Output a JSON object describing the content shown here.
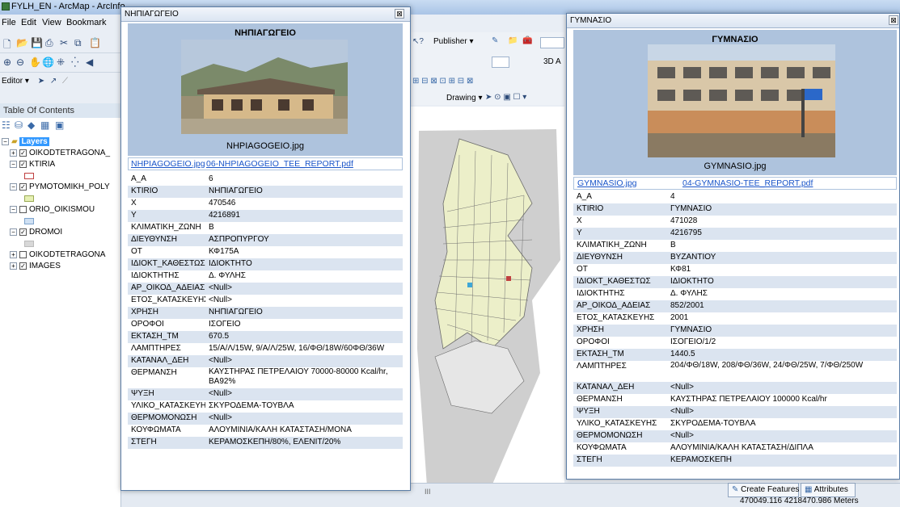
{
  "app": {
    "title": "FYLH_EN - ArcMap - ArcInfo",
    "menu": [
      "File",
      "Edit",
      "View",
      "Bookmark"
    ],
    "editor_label": "Editor ▾",
    "toc_title": "Table Of Contents",
    "publisher_label": "Publisher ▾",
    "drawing_label": "Drawing ▾",
    "three_d_label": "3D A",
    "status_coords": "470049.116 4218470.986 Meters",
    "tab_create_features": "Create Features",
    "tab_attributes": "Attributes",
    "scroll_mark": "III"
  },
  "toc": {
    "root": "Layers",
    "layers": [
      {
        "name": "OIKODTETRAGONA_",
        "checked": true,
        "expanded": false
      },
      {
        "name": "KTIRIA",
        "checked": true,
        "expanded": true,
        "swatch": "#c04040"
      },
      {
        "name": "PYMOTOMIKH_POLY",
        "checked": true,
        "expanded": true,
        "swatch": "#e6f0b4"
      },
      {
        "name": "ORIO_OIKISMOU",
        "checked": false,
        "expanded": true,
        "swatch": "#cfe0f3"
      },
      {
        "name": "DROMOI",
        "checked": true,
        "expanded": true,
        "swatch": "#d8d8d8"
      },
      {
        "name": "OIKODTETRAGONA",
        "checked": false,
        "expanded": false
      },
      {
        "name": "IMAGES",
        "checked": true,
        "expanded": false
      }
    ]
  },
  "popup_left": {
    "window_title": "ΝΗΠΙΑΓΩΓΕΙΟ",
    "header": "ΝΗΠΙΑΓΩΓΕΙΟ",
    "caption": "NHPIAGOGEIO.jpg",
    "link1": "NHPIAGOGEIO.jpg",
    "link2": "06-NHPIAGOGEIO_TEE_REPORT.pdf",
    "rows": [
      [
        "A_A",
        "6"
      ],
      [
        "KTIRIO",
        "ΝΗΠΙΑΓΩΓΕΙΟ"
      ],
      [
        "X",
        "470546"
      ],
      [
        "Y",
        "4216891"
      ],
      [
        "ΚΛΙΜΑΤΙΚΗ_ΖΩΝΗ",
        "Β"
      ],
      [
        "ΔΙΕΥΘΥΝΣΗ",
        "ΑΣΠΡΟΠΥΡΓΟΥ"
      ],
      [
        "ΟΤ",
        "ΚΦ175Α"
      ],
      [
        "ΙΔΙΟΚΤ_ΚΑΘΕΣΤΩΣ",
        "ΙΔΙΟΚΤΗΤΟ"
      ],
      [
        "ΙΔΙΟΚΤΗΤΗΣ",
        "Δ. ΦΥΛΗΣ"
      ],
      [
        "ΑΡ_ΟΙΚΟΔ_ΑΔΕΙΑΣ",
        "<Null>"
      ],
      [
        "ΕΤΟΣ_ΚΑΤΑΣΚΕΥΗΣ",
        "<Null>"
      ],
      [
        "ΧΡΗΣΗ",
        "ΝΗΠΙΑΓΩΓΕΙΟ"
      ],
      [
        "ΟΡΟΦΟΙ",
        "ΙΣΟΓΕΙΟ"
      ],
      [
        "ΕΚΤΑΣΗ_ΤΜ",
        "670.5"
      ],
      [
        "ΛΑΜΠΤΗΡΕΣ",
        "15/Α/Λ/15W, 9/Α/Λ/25W, 16/ΦΘ/18W/60ΦΘ/36W"
      ],
      [
        "ΚΑΤΑΝΑΛ_ΔΕΗ",
        "<Null>"
      ],
      [
        "ΘΕΡΜΑΝΣΗ",
        "ΚΑΥΣΤΗΡΑΣ ΠΕΤΡΕΛΑΙΟΥ 70000-80000 Kcal/hr, ΒΑ92%"
      ],
      [
        "ΨΥΞΗ",
        "<Null>"
      ],
      [
        "ΥΛΙΚΟ_ΚΑΤΑΣΚΕΥΗΣ",
        "ΣΚΥΡΟΔΕΜΑ-ΤΟΥΒΛΑ"
      ],
      [
        "ΘΕΡΜΟΜΟΝΩΣΗ",
        "<Null>"
      ],
      [
        "ΚΟΥΦΩΜΑΤΑ",
        "ΑΛΟΥΜΙΝΙΑ/ΚΑΛΗ ΚΑΤΑΣΤΑΣΗ/ΜΟΝΑ"
      ],
      [
        "ΣΤΕΓΗ",
        "ΚΕΡΑΜΟΣΚΕΠΗ/80%, ΕΛΕΝΙΤ/20%"
      ]
    ]
  },
  "popup_right": {
    "window_title": "ΓΥΜΝΑΣΙΟ",
    "header": "ΓΥΜΝΑΣΙΟ",
    "caption": "GYMNASIO.jpg",
    "link1": "GYMNASIO.jpg",
    "link2": "04-GYMNASIO-TEE_REPORT.pdf",
    "rows": [
      [
        "A_A",
        "4"
      ],
      [
        "KTIRIO",
        "ΓΥΜΝΑΣΙΟ"
      ],
      [
        "X",
        "471028"
      ],
      [
        "Y",
        "4216795"
      ],
      [
        "ΚΛΙΜΑΤΙΚΗ_ΖΩΝΗ",
        "Β"
      ],
      [
        "ΔΙΕΥΘΥΝΣΗ",
        "ΒΥΖΑΝΤΙΟΥ"
      ],
      [
        "ΟΤ",
        "ΚΦ81"
      ],
      [
        "ΙΔΙΟΚΤ_ΚΑΘΕΣΤΩΣ",
        "ΙΔΙΟΚΤΗΤΟ"
      ],
      [
        "ΙΔΙΟΚΤΗΤΗΣ",
        "Δ. ΦΥΛΗΣ"
      ],
      [
        "ΑΡ_ΟΙΚΟΔ_ΑΔΕΙΑΣ",
        "852/2001"
      ],
      [
        "ΕΤΟΣ_ΚΑΤΑΣΚΕΥΗΣ",
        "2001"
      ],
      [
        "ΧΡΗΣΗ",
        "ΓΥΜΝΑΣΙΟ"
      ],
      [
        "ΟΡΟΦΟΙ",
        "ΙΣΟΓΕΙΟ/1/2"
      ],
      [
        "ΕΚΤΑΣΗ_ΤΜ",
        "1440.5"
      ],
      [
        "ΛΑΜΠΤΗΡΕΣ",
        "204/ΦΘ/18W, 208/ΦΘ/36W, 24/ΦΘ/25W, 7/ΦΘ/250W"
      ],
      [
        "ΚΑΤΑΝΑΛ_ΔΕΗ",
        "<Null>"
      ],
      [
        "ΘΕΡΜΑΝΣΗ",
        "ΚΑΥΣΤΗΡΑΣ ΠΕΤΡΕΛΑΙΟΥ 100000 Kcal/hr"
      ],
      [
        "ΨΥΞΗ",
        "<Null>"
      ],
      [
        "ΥΛΙΚΟ_ΚΑΤΑΣΚΕΥΗΣ",
        "ΣΚΥΡΟΔΕΜΑ-ΤΟΥΒΛΑ"
      ],
      [
        "ΘΕΡΜΟΜΟΝΩΣΗ",
        "<Null>"
      ],
      [
        "ΚΟΥΦΩΜΑΤΑ",
        "ΑΛΟΥΜΙΝΙΑ/ΚΑΛΗ ΚΑΤΑΣΤΑΣΗ/ΔΙΠΛΑ"
      ],
      [
        "ΣΤΕΓΗ",
        "ΚΕΡΑΜΟΣΚΕΠΗ"
      ]
    ]
  },
  "colors": {
    "popup_header": "#aec3dd",
    "row_alt": "#dbe4f0",
    "link": "#1a55c9",
    "toc_selected": "#3399ff"
  }
}
